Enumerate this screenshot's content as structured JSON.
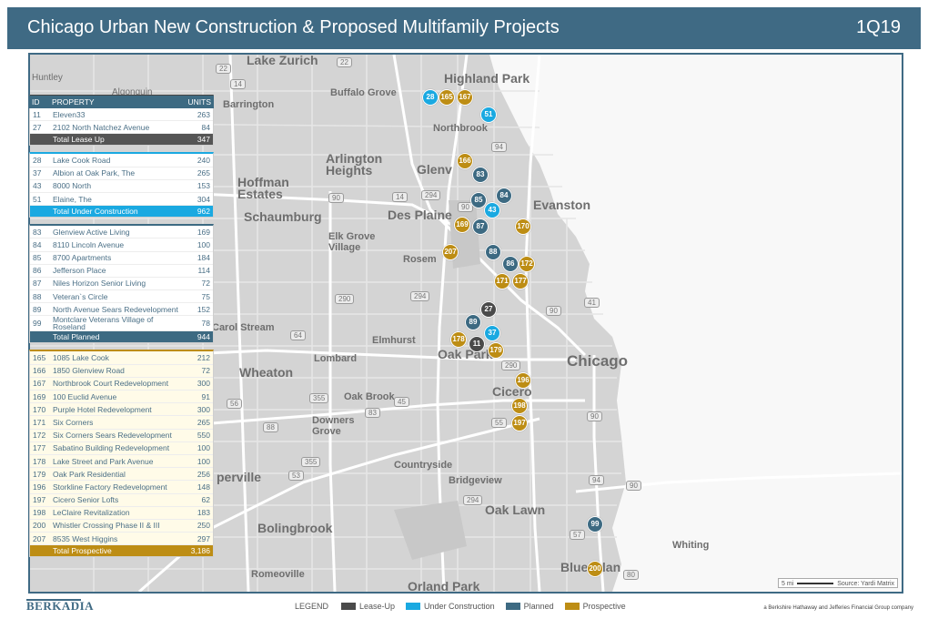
{
  "header": {
    "title": "Chicago Urban New Construction & Proposed Multifamily Projects",
    "quarter": "1Q19"
  },
  "colors": {
    "lease_up": "#4a4a4a",
    "under_construction": "#1aa9e1",
    "planned": "#3d6a82",
    "prospective": "#bd8d14",
    "brand": "#3f6a84"
  },
  "table": {
    "col_id": "ID",
    "col_property": "PROPERTY",
    "col_units": "UNITS",
    "lease_up": {
      "rows": [
        {
          "id": "11",
          "name": "Eleven33",
          "units": "263"
        },
        {
          "id": "27",
          "name": "2102 North Natchez Avenue",
          "units": "84"
        }
      ],
      "total_label": "Total Lease Up",
      "total": "347"
    },
    "under_construction": {
      "rows": [
        {
          "id": "28",
          "name": "Lake Cook Road",
          "units": "240"
        },
        {
          "id": "37",
          "name": "Albion at Oak Park, The",
          "units": "265"
        },
        {
          "id": "43",
          "name": "8000 North",
          "units": "153"
        },
        {
          "id": "51",
          "name": "Elaine, The",
          "units": "304"
        }
      ],
      "total_label": "Total Under Construction",
      "total": "962"
    },
    "planned": {
      "rows": [
        {
          "id": "83",
          "name": "Glenview Active Living",
          "units": "169"
        },
        {
          "id": "84",
          "name": "8110 Lincoln Avenue",
          "units": "100"
        },
        {
          "id": "85",
          "name": "8700 Apartments",
          "units": "184"
        },
        {
          "id": "86",
          "name": "Jefferson Place",
          "units": "114"
        },
        {
          "id": "87",
          "name": "Niles Horizon Senior Living",
          "units": "72"
        },
        {
          "id": "88",
          "name": "Veteran`s Circle",
          "units": "75"
        },
        {
          "id": "89",
          "name": "North Avenue Sears Redevelopment",
          "units": "152"
        },
        {
          "id": "99",
          "name": "Montclare Veterans Village of Roseland",
          "units": "78"
        }
      ],
      "total_label": "Total Planned",
      "total": "944"
    },
    "prospective": {
      "rows": [
        {
          "id": "165",
          "name": "1085 Lake Cook",
          "units": "212"
        },
        {
          "id": "166",
          "name": "1850 Glenview Road",
          "units": "72"
        },
        {
          "id": "167",
          "name": "Northbrook Court Redevelopment",
          "units": "300"
        },
        {
          "id": "169",
          "name": "100 Euclid Avenue",
          "units": "91"
        },
        {
          "id": "170",
          "name": "Purple Hotel Redevelopment",
          "units": "300"
        },
        {
          "id": "171",
          "name": "Six Corners",
          "units": "265"
        },
        {
          "id": "172",
          "name": "Six Corners Sears Redevelopment",
          "units": "550"
        },
        {
          "id": "177",
          "name": "Sabatino Building Redevelopment",
          "units": "100"
        },
        {
          "id": "178",
          "name": "Lake Street and Park Avenue",
          "units": "100"
        },
        {
          "id": "179",
          "name": "Oak Park Residential",
          "units": "256"
        },
        {
          "id": "196",
          "name": "Storkline Factory Redevelopment",
          "units": "148"
        },
        {
          "id": "197",
          "name": "Cicero Senior Lofts",
          "units": "62"
        },
        {
          "id": "198",
          "name": "LeClaire Revitalization",
          "units": "183"
        },
        {
          "id": "200",
          "name": "Whistler Crossing Phase II & III",
          "units": "250"
        },
        {
          "id": "207",
          "name": "8535 West Higgins",
          "units": "297"
        }
      ],
      "total_label": "Total Prospective",
      "total": "3,186"
    }
  },
  "map": {
    "places": {
      "lake_zurich": "Lake Zurich",
      "highland_park": "Highland Park",
      "huntley": "Huntley",
      "algonquin": "Algonquin",
      "buffalo_grove": "Buffalo Grove",
      "barrington": "Barrington",
      "northbrook": "Northbrook",
      "arlington_heights": "Arlington Heights",
      "glenview": "Glenv",
      "hoffman_estates": "Hoffman Estates",
      "evanston": "Evanston",
      "schaumburg": "Schaumburg",
      "des_plaines": "Des Plaine",
      "elk_grove_village": "Elk Grove Village",
      "rosemont": "Rosem",
      "carol_stream": "Carol Stream",
      "elmhurst": "Elmhurst",
      "oak_park": "Oak Park",
      "lombard": "Lombard",
      "chicago": "Chicago",
      "wheaton": "Wheaton",
      "oak_brook": "Oak Brook",
      "cicero": "Cicero",
      "downers_grove": "Downers Grove",
      "naperville": "perville",
      "countryside": "Countryside",
      "bridgeview": "Bridgeview",
      "oak_lawn": "Oak Lawn",
      "bolingbrook": "Bolingbrook",
      "whiting": "Whiting",
      "blue_island": "Blue Islan",
      "romeoville": "Romeoville",
      "orland_park": "Orland Park"
    },
    "highways": [
      "22",
      "22",
      "14",
      "94",
      "90",
      "14",
      "294",
      "90",
      "294",
      "290",
      "64",
      "290",
      "41",
      "90",
      "355",
      "45",
      "56",
      "83",
      "88",
      "55",
      "90",
      "53",
      "355",
      "294",
      "94",
      "90",
      "57",
      "80"
    ],
    "scale_label": "5 mi",
    "source": "Source: Yardi Matrix"
  },
  "markers": [
    {
      "id": "28",
      "cat": "uc"
    },
    {
      "id": "165",
      "cat": "prospect"
    },
    {
      "id": "167",
      "cat": "prospect"
    },
    {
      "id": "51",
      "cat": "uc"
    },
    {
      "id": "166",
      "cat": "prospect"
    },
    {
      "id": "83",
      "cat": "planned"
    },
    {
      "id": "84",
      "cat": "planned"
    },
    {
      "id": "85",
      "cat": "planned"
    },
    {
      "id": "43",
      "cat": "uc"
    },
    {
      "id": "169",
      "cat": "prospect"
    },
    {
      "id": "87",
      "cat": "planned"
    },
    {
      "id": "170",
      "cat": "prospect"
    },
    {
      "id": "207",
      "cat": "prospect"
    },
    {
      "id": "88",
      "cat": "planned"
    },
    {
      "id": "86",
      "cat": "planned"
    },
    {
      "id": "172",
      "cat": "prospect"
    },
    {
      "id": "171",
      "cat": "prospect"
    },
    {
      "id": "177",
      "cat": "prospect"
    },
    {
      "id": "27",
      "cat": "lease"
    },
    {
      "id": "89",
      "cat": "planned"
    },
    {
      "id": "37",
      "cat": "uc"
    },
    {
      "id": "178",
      "cat": "prospect"
    },
    {
      "id": "11",
      "cat": "lease"
    },
    {
      "id": "179",
      "cat": "prospect"
    },
    {
      "id": "196",
      "cat": "prospect"
    },
    {
      "id": "198",
      "cat": "prospect"
    },
    {
      "id": "197",
      "cat": "prospect"
    },
    {
      "id": "99",
      "cat": "planned"
    },
    {
      "id": "200",
      "cat": "prospect"
    }
  ],
  "footer": {
    "logo": "BERKADIA",
    "legend_title": "LEGEND",
    "legend_items": [
      {
        "label": "Lease-Up",
        "color": "#4a4a4a"
      },
      {
        "label": "Under Construction",
        "color": "#1aa9e1"
      },
      {
        "label": "Planned",
        "color": "#3d6a82"
      },
      {
        "label": "Prospective",
        "color": "#bd8d14"
      }
    ],
    "tagline": "a Berkshire Hathaway and Jefferies Financial Group company"
  }
}
